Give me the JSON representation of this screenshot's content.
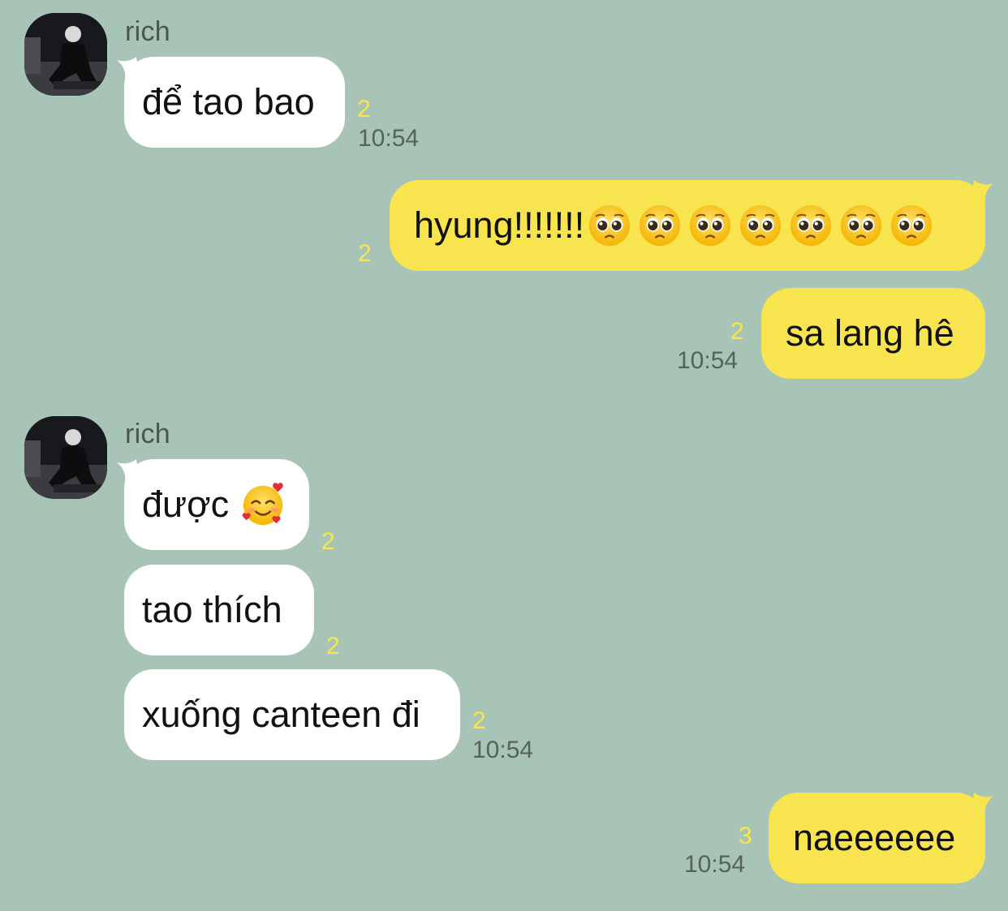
{
  "colors": {
    "background": "#a7c4b6",
    "incoming_bubble": "#ffffff",
    "outgoing_bubble": "#f8e44f",
    "read_count": "#f8e74a",
    "timestamp": "#55635c"
  },
  "messages": [
    {
      "sender": "rich",
      "text": "để tao bao",
      "read_count": "2",
      "time": "10:54"
    },
    {
      "sender": "me",
      "text": "hyung!!!!!!!",
      "emoji": "pleading-face-icon",
      "emoji_count": 7,
      "read_count": "2"
    },
    {
      "sender": "me",
      "text": "sa lang hê",
      "read_count": "2",
      "time": "10:54"
    },
    {
      "sender": "rich",
      "text": "được",
      "emoji": "smiling-face-with-hearts-icon",
      "read_count": "2"
    },
    {
      "sender": "rich",
      "text": "tao thích",
      "read_count": "2"
    },
    {
      "sender": "rich",
      "text": "xuống canteen đi",
      "read_count": "2",
      "time": "10:54"
    },
    {
      "sender": "me",
      "text": "naeeeeee",
      "read_count": "3",
      "time": "10:54"
    }
  ]
}
